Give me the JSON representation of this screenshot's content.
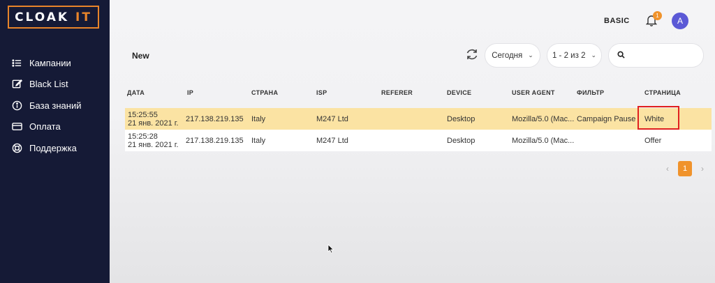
{
  "brand": {
    "logo_main": "CLOAK",
    "logo_accent": "IT",
    "accent_color": "#e8842a"
  },
  "sidebar": {
    "items": [
      {
        "label": "Кампании",
        "icon": "list-icon"
      },
      {
        "label": "Black List",
        "icon": "edit-icon"
      },
      {
        "label": "База знаний",
        "icon": "info-icon"
      },
      {
        "label": "Оплата",
        "icon": "card-icon"
      },
      {
        "label": "Поддержка",
        "icon": "lifebuoy-icon"
      }
    ]
  },
  "header": {
    "plan": "BASIC",
    "notifications_count": "1",
    "avatar_letter": "A"
  },
  "page": {
    "heading": "New"
  },
  "toolbar": {
    "date_filter": "Сегодня",
    "range": "1 - 2 из 2",
    "search_placeholder": ""
  },
  "table": {
    "columns": [
      "ДАТА",
      "IP",
      "СТРАНА",
      "ISP",
      "REFERER",
      "DEVICE",
      "USER AGENT",
      "ФИЛЬТР",
      "СТРАНИЦА"
    ],
    "rows": [
      {
        "time": "15:25:55",
        "date": "21 янв. 2021 г.",
        "ip": "217.138.219.135",
        "country": "Italy",
        "isp": "M247 Ltd",
        "referer": "",
        "device": "Desktop",
        "ua": "Mozilla/5.0 (Mac...",
        "filter": "Campaign Pause",
        "page": "White",
        "highlighted": true
      },
      {
        "time": "15:25:28",
        "date": "21 янв. 2021 г.",
        "ip": "217.138.219.135",
        "country": "Italy",
        "isp": "M247 Ltd",
        "referer": "",
        "device": "Desktop",
        "ua": "Mozilla/5.0 (Mac...",
        "filter": "",
        "page": "Offer",
        "highlighted": false
      }
    ]
  },
  "pagination": {
    "prev": "‹",
    "current": "1",
    "next": "›"
  },
  "colors": {
    "sidebar_bg": "#151a36",
    "highlight_row": "#fbe3a3",
    "accent": "#f0932c",
    "avatar_bg": "#5b59d6",
    "annotation": "#e02020"
  }
}
